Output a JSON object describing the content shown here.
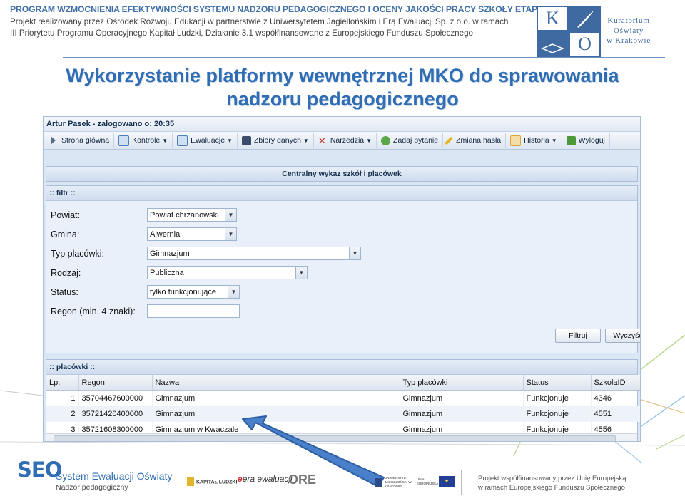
{
  "header": {
    "line1": "PROGRAM WZMOCNIENIA EFEKTYWNOŚCI SYSTEMU NADZORU PEDAGOGICZNEGO I OCENY JAKOŚCI PRACY SZKOŁY ETAP III",
    "line2": "Projekt realizowany przez Ośrodek Rozwoju Edukacji w partnerstwie z Uniwersytetem Jagiellońskim i Erą Ewaluacji Sp. z o.o. w ramach",
    "line3": "III Priorytetu Programu Operacyjnego Kapitał Ludzki, Działanie 3.1 współfinansowane z Europejskiego Funduszu Społecznego"
  },
  "logo": {
    "letter1": "K",
    "letter2": "O",
    "word1": "Kuratorium",
    "word2": "Oświaty",
    "word3": "w Krakowie"
  },
  "title": {
    "line1": "Wykorzystanie platformy wewnętrznej MKO do sprawowania",
    "line2": "nadzoru pedagogicznego"
  },
  "app": {
    "user_status": "Artur Pasek - zalogowano o: 20:35",
    "menu": [
      {
        "label": "Strona główna",
        "icon": "play-icon",
        "color": "#5a6d86",
        "dropdown": false
      },
      {
        "label": "Kontrole",
        "icon": "document-icon",
        "color": "#4f7fb8",
        "dropdown": true
      },
      {
        "label": "Ewaluacje",
        "icon": "document-icon",
        "color": "#4f7fb8",
        "dropdown": true
      },
      {
        "label": "Zbiory danych",
        "icon": "database-icon",
        "color": "#3b4d6a",
        "dropdown": true
      },
      {
        "label": "Narzedzia",
        "icon": "tools-icon",
        "color": "#c0392b",
        "dropdown": true
      },
      {
        "label": "Zadaj pytanie",
        "icon": "question-icon",
        "color": "#5aa84a",
        "dropdown": false
      },
      {
        "label": "Zmiana hasła",
        "icon": "pencil-icon",
        "color": "#e6b522",
        "dropdown": false
      },
      {
        "label": "Historia",
        "icon": "history-icon",
        "color": "#d9a441",
        "dropdown": true
      },
      {
        "label": "Wyloguj",
        "icon": "logout-icon",
        "color": "#4c9a3c",
        "dropdown": false
      }
    ],
    "panel_title": "Centralny wykaz szkół i placówek",
    "filter": {
      "heading": ":: filtr ::",
      "powiat_label": "Powiat:",
      "powiat_value": "Powiat chrzanowski",
      "gmina_label": "Gmina:",
      "gmina_value": "Alwernia",
      "typ_label": "Typ placówki:",
      "typ_value": "Gimnazjum",
      "rodzaj_label": "Rodzaj:",
      "rodzaj_value": "Publiczna",
      "status_label": "Status:",
      "status_value": "tylko funkcjonujące",
      "regon_label": "Regon (min. 4 znaki):",
      "regon_value": "",
      "filter_button": "Filtruj",
      "clear_button": "Wyczyść"
    },
    "placowki": {
      "heading": ":: placówki ::",
      "columns": [
        "Lp.",
        "Regon",
        "Nazwa",
        "Typ placówki",
        "Status",
        "SzkolaID"
      ],
      "rows": [
        [
          "1",
          "35704467600000",
          "Gimnazjum",
          "Gimnazjum",
          "Funkcjonuje",
          "4346"
        ],
        [
          "2",
          "35721420400000",
          "Gimnazjum",
          "Gimnazjum",
          "Funkcjonuje",
          "4551"
        ],
        [
          "3",
          "35721608300000",
          "Gimnazjum w Kwaczale",
          "Gimnazjum",
          "Funkcjonuje",
          "4556"
        ]
      ]
    }
  },
  "footer": {
    "seo_mark": "SEO",
    "seo_title": "System Ewaluacji Oświaty",
    "seo_subtitle": "Nadzór pedagogiczny",
    "kapital_ludzki": "KAPITAŁ LUDZKI",
    "era_ewaluacji": "era ewaluacji",
    "ore": "ORE",
    "uj": "UNIWERSYTET JAGIELLOŃSKI W KRAKOWIE",
    "ue": "UNIA EUROPEJSKA",
    "cofunded_line1": "Projekt współfinansowany przez Unię Europejską",
    "cofunded_line2": "w ramach Europejskiego Funduszu Społecznego"
  },
  "colors": {
    "title": "#2f6db5",
    "header_accent": "#3f6fa8",
    "arrow": "#4a7fc9",
    "window_bg": "#dbe6f5"
  }
}
